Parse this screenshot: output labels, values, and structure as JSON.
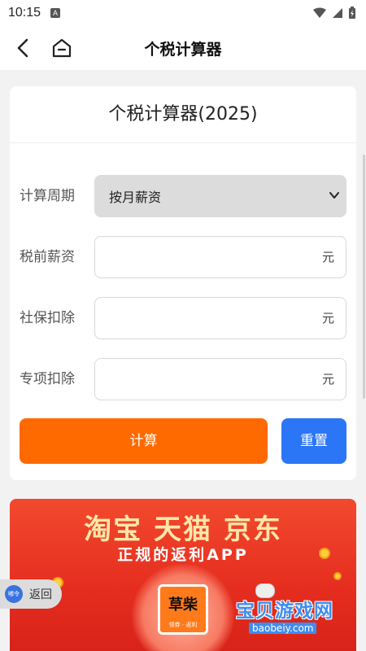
{
  "status_bar": {
    "time": "10:15",
    "notif_letter": "A"
  },
  "nav": {
    "title": "个税计算器"
  },
  "card": {
    "title": "个税计算器(2025)",
    "period": {
      "label": "计算周期",
      "selected": "按月薪资"
    },
    "salary": {
      "label": "税前薪资",
      "unit": "元",
      "value": ""
    },
    "social": {
      "label": "社保扣除",
      "unit": "元",
      "value": ""
    },
    "special": {
      "label": "专项扣除",
      "unit": "元",
      "value": ""
    },
    "calc_label": "计算",
    "reset_label": "重置"
  },
  "banner": {
    "line1": "淘宝 天猫 京东",
    "line2": "正规的返利APP",
    "app_name": "草柴",
    "app_sub": "领券 · 返利"
  },
  "watermark": {
    "text": "宝贝游戏网",
    "url": "baobeiy.com"
  },
  "float_back": {
    "icon_text": "嘟令",
    "label": "返回"
  },
  "colors": {
    "calc": "#ff6a00",
    "reset": "#2b76f6",
    "banner": "#e52d1f"
  }
}
